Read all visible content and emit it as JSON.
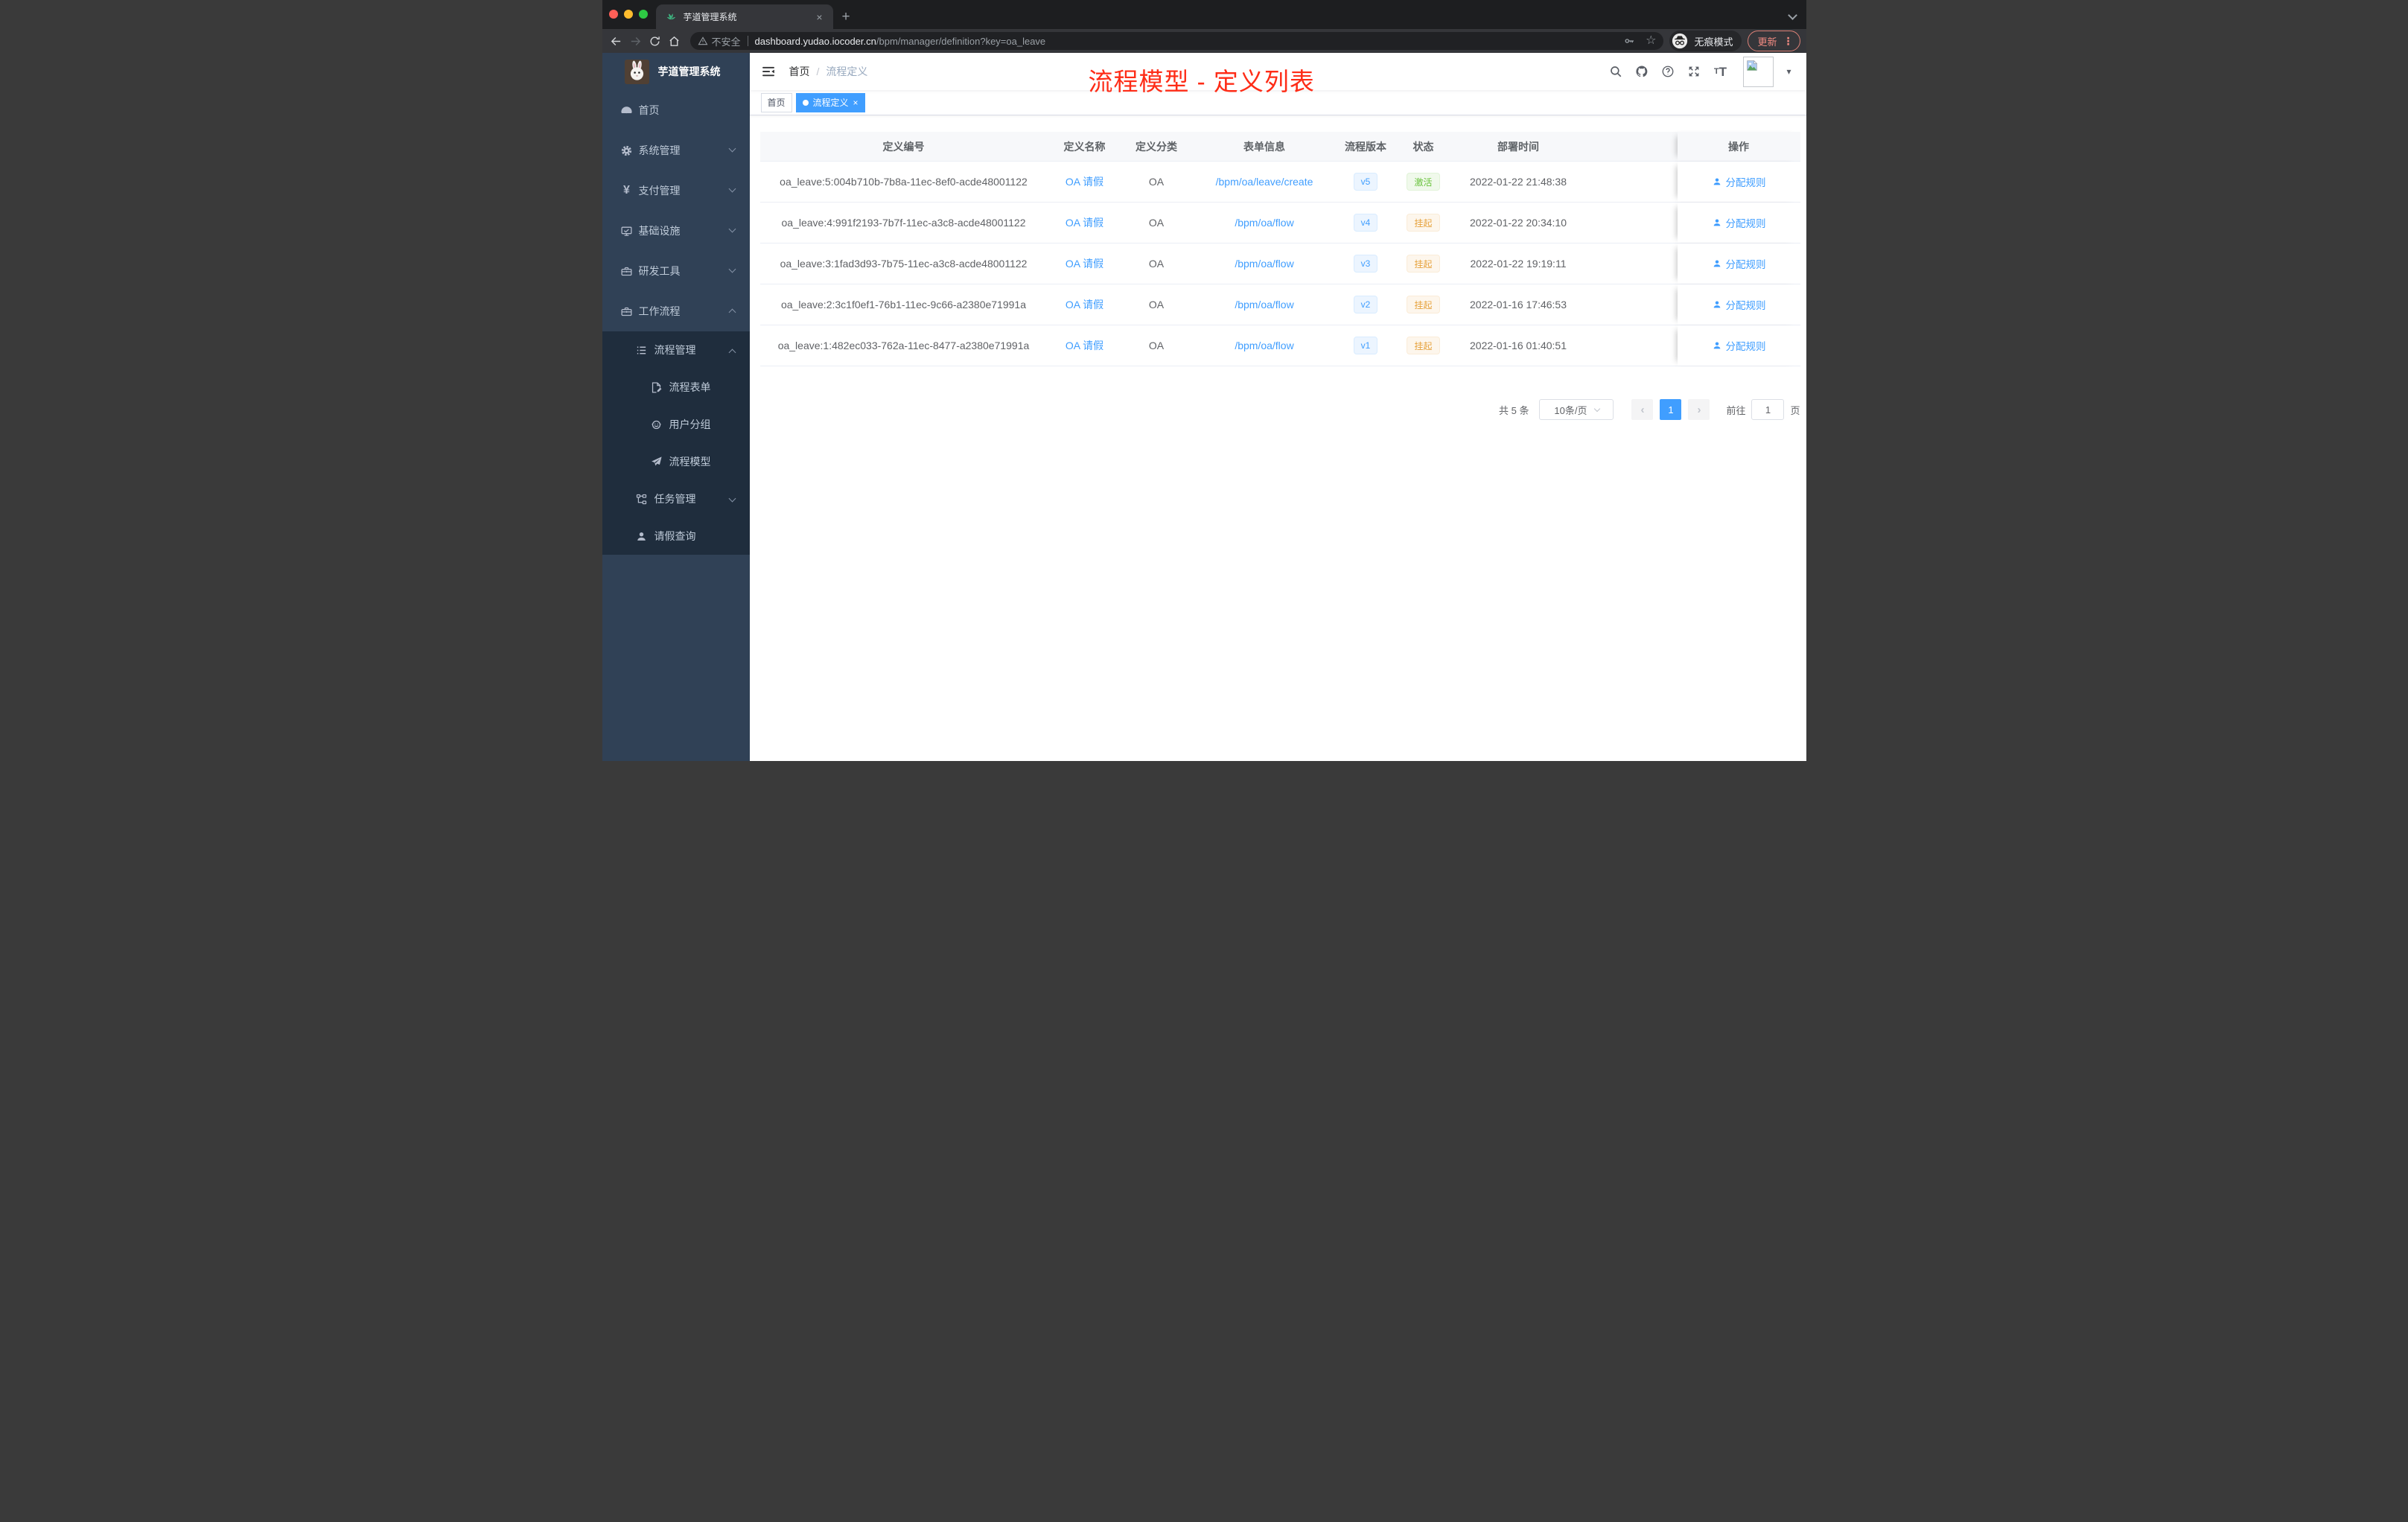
{
  "browser": {
    "tab_title": "芋道管理系统",
    "security_label": "不安全",
    "url_host": "dashboard.yudao.iocoder.cn",
    "url_path": "/bpm/manager/definition?key=oa_leave",
    "incognito_label": "无痕模式",
    "update_label": "更新"
  },
  "icons": {
    "close": "×",
    "new_tab": "+",
    "star": "☆",
    "kebab": "⋮",
    "caret_down": "▾",
    "yen": "¥",
    "prev": "‹",
    "next": "›"
  },
  "sidebar": {
    "title": "芋道管理系统",
    "items": [
      {
        "label": "首页"
      },
      {
        "label": "系统管理"
      },
      {
        "label": "支付管理"
      },
      {
        "label": "基础设施"
      },
      {
        "label": "研发工具"
      },
      {
        "label": "工作流程"
      }
    ],
    "submenu": [
      {
        "label": "流程管理"
      },
      {
        "label": "流程表单"
      },
      {
        "label": "用户分组"
      },
      {
        "label": "流程模型"
      },
      {
        "label": "任务管理"
      },
      {
        "label": "请假查询"
      }
    ]
  },
  "navbar": {
    "breadcrumb_home": "首页",
    "breadcrumb_sep": "/",
    "breadcrumb_current": "流程定义",
    "annotation": "流程模型 - 定义列表"
  },
  "tags": {
    "home": "首页",
    "active": "流程定义"
  },
  "table": {
    "columns": [
      "定义编号",
      "定义名称",
      "定义分类",
      "表单信息",
      "流程版本",
      "状态",
      "部署时间",
      "操作"
    ],
    "rows": [
      {
        "id": "oa_leave:5:004b710b-7b8a-11ec-8ef0-acde48001122",
        "name": "OA 请假",
        "category": "OA",
        "form": "/bpm/oa/leave/create",
        "version": "v5",
        "status": "激活",
        "status_type": "success",
        "time": "2022-01-22 21:48:38",
        "action": "分配规则"
      },
      {
        "id": "oa_leave:4:991f2193-7b7f-11ec-a3c8-acde48001122",
        "name": "OA 请假",
        "category": "OA",
        "form": "/bpm/oa/flow",
        "version": "v4",
        "status": "挂起",
        "status_type": "warning",
        "time": "2022-01-22 20:34:10",
        "action": "分配规则"
      },
      {
        "id": "oa_leave:3:1fad3d93-7b75-11ec-a3c8-acde48001122",
        "name": "OA 请假",
        "category": "OA",
        "form": "/bpm/oa/flow",
        "version": "v3",
        "status": "挂起",
        "status_type": "warning",
        "time": "2022-01-22 19:19:11",
        "action": "分配规则"
      },
      {
        "id": "oa_leave:2:3c1f0ef1-76b1-11ec-9c66-a2380e71991a",
        "name": "OA 请假",
        "category": "OA",
        "form": "/bpm/oa/flow",
        "version": "v2",
        "status": "挂起",
        "status_type": "warning",
        "time": "2022-01-16 17:46:53",
        "action": "分配规则"
      },
      {
        "id": "oa_leave:1:482ec033-762a-11ec-8477-a2380e71991a",
        "name": "OA 请假",
        "category": "OA",
        "form": "/bpm/oa/flow",
        "version": "v1",
        "status": "挂起",
        "status_type": "warning",
        "time": "2022-01-16 01:40:51",
        "action": "分配规则"
      }
    ]
  },
  "pagination": {
    "total": "共 5 条",
    "page_size": "10条/页",
    "current_page": "1",
    "goto_label": "前往",
    "goto_value": "1",
    "page_label": "页"
  },
  "colors": {
    "accent_blue": "#409eff",
    "annotation_red": "#fe2c17",
    "sidebar_bg": "#304156",
    "submenu_bg": "#1f2d3d",
    "status_active_green": "#67c23a",
    "status_suspend_orange": "#e6a23c"
  }
}
